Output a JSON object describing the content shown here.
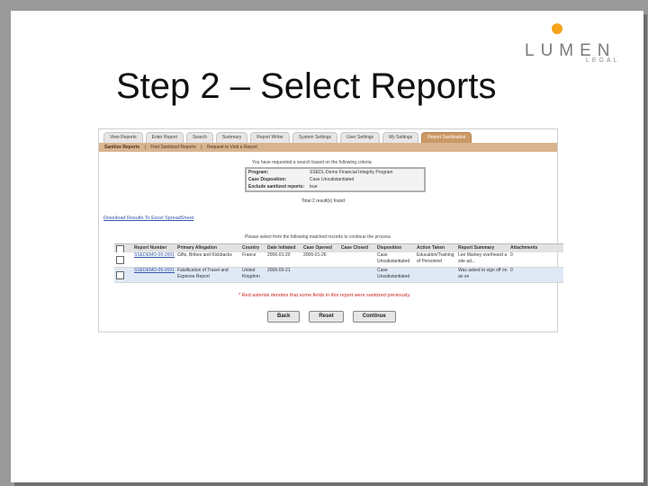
{
  "slide": {
    "title": "Step 2 – Select Reports",
    "logo_word": "LUMEN",
    "logo_sub": "LEGAL"
  },
  "app": {
    "tabs": [
      "View Reports",
      "Enter Report",
      "Search",
      "Summary",
      "Report Writer",
      "System Settings",
      "User Settings",
      "My Settings",
      "Report Sanitization"
    ],
    "active_tab": "Report Sanitization",
    "subnav": [
      "Sanitize Reports",
      "|",
      "Find Sanitized Reports",
      "|",
      "Request to Void a Report"
    ],
    "criteria_title": "You have requested a search based on the following criteria:",
    "criteria": [
      {
        "label": "Program:",
        "value": "SSEDL-Demo Financial Integrity Program"
      },
      {
        "label": "Case Disposition:",
        "value": "Case Unsubstantiated"
      },
      {
        "label": "Exclude sanitized reports:",
        "value": "true"
      }
    ],
    "total": "Total 2 result(s) found",
    "download_link": "Download Results To Excel SpreadSheet",
    "grid_title": "Please select from the following matched records to continue the process",
    "columns": [
      "All",
      "Report Number",
      "Primary Allegation",
      "Country",
      "Date Initiated",
      "Case Opened",
      "Case Closed",
      "Disposition",
      "Action Taken",
      "Report Summary",
      "Attachments"
    ],
    "rows": [
      {
        "report_number": "SSEDEMO-05-2001",
        "allegation": "Gifts, Bribes and Kickbacks",
        "country": "France",
        "initiated": "2006-01-20",
        "opened": "2006-01-26",
        "closed": "",
        "disposition": "Case Unsubstantiated",
        "action": "Education/Training of Personnel",
        "summary": "Lee Markey overheard a site ad...",
        "attachments": "0"
      },
      {
        "report_number": "SSEDEMO-05-2001",
        "allegation": "Falsification of Travel and Expense Report",
        "country": "United Kingdom",
        "initiated": "2006-05-21",
        "opened": "",
        "closed": "",
        "disposition": "Case Unsubstantiated",
        "action": "",
        "summary": "Was asked to sign off on an ex",
        "attachments": "0"
      }
    ],
    "note": "* Red asterisk denotes that some fields in this report were sanitized previously.",
    "buttons": {
      "back": "Back",
      "reset": "Reset",
      "continue": "Continue"
    }
  },
  "colors": {
    "accent": "#cc9966",
    "logo_dot": "#f4a31a",
    "note_red": "#cc2222",
    "link": "#3355aa"
  }
}
